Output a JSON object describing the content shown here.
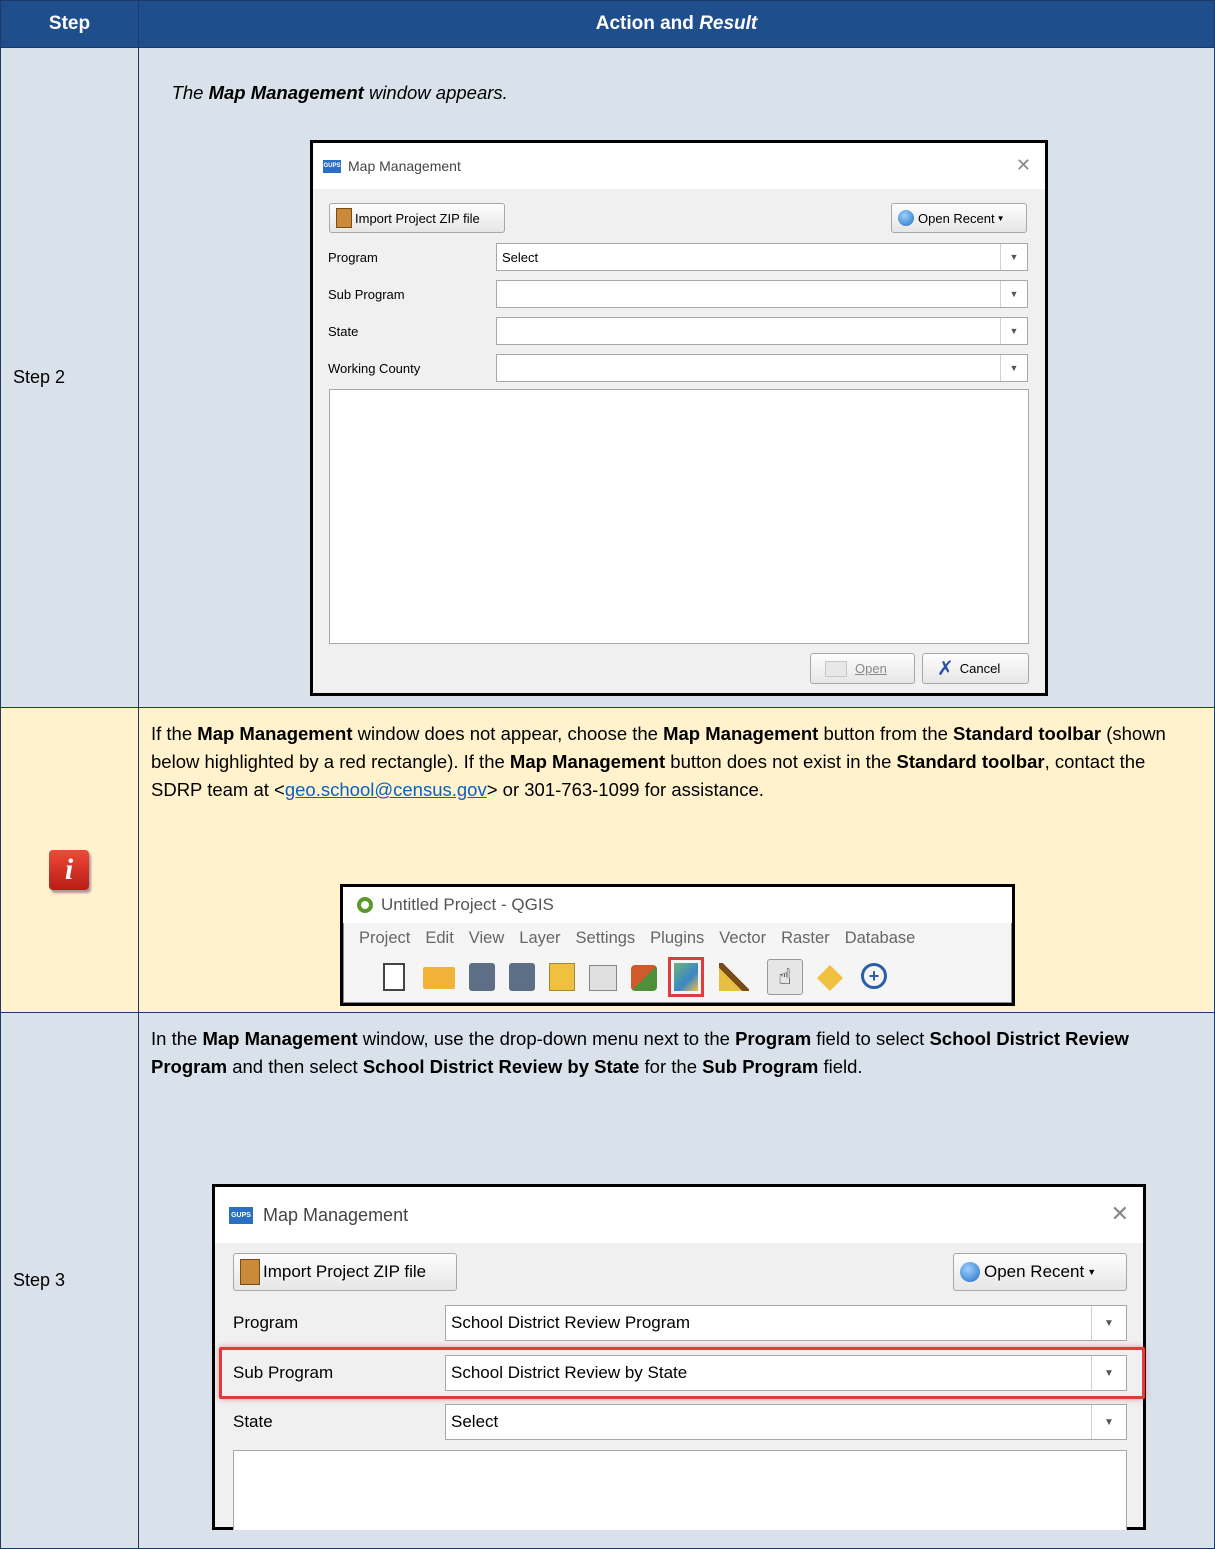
{
  "table": {
    "header_step": "Step",
    "header_action": "Action and ",
    "header_result": "Result"
  },
  "row1": {
    "step": "Step 2",
    "caption_pre": "The ",
    "caption_bold": "Map Management",
    "caption_post": " window appears."
  },
  "dialog1": {
    "title": "Map Management",
    "import_button": "Import Project ZIP file",
    "open_recent_button": "Open Recent",
    "labels": [
      "Program",
      "Sub Program",
      "State",
      "Working County"
    ],
    "values": [
      "Select",
      "",
      "",
      ""
    ],
    "open_button": "Open",
    "cancel_button": "Cancel"
  },
  "note": {
    "t1": "If the ",
    "b1": "Map Management",
    "t2": " window does not appear, choose the ",
    "b2": "Map Management",
    "t3": " button from the ",
    "b3": "Standard toolbar",
    "t4": " (shown below highlighted by a red rectangle). If the ",
    "b4": "Map Management",
    "t5": " button does not exist in the ",
    "b5": "Standard toolbar",
    "t6": ", contact the SDRP team at <",
    "email": "geo.school@census.gov",
    "t7": "> or 301-763-1099 for assistance.",
    "info_icon_letter": "i"
  },
  "qgis": {
    "title": "Untitled Project - QGIS",
    "menu": [
      "Project",
      "Edit",
      "View",
      "Layer",
      "Settings",
      "Plugins",
      "Vector",
      "Raster",
      "Database"
    ]
  },
  "row3": {
    "step": "Step 3",
    "t1": "In the ",
    "b1": "Map Management",
    "t2": " window, use the drop-down menu next to the ",
    "b2": "Program",
    "t3": " field to select ",
    "b3": "School District Review Program",
    "t4": " and then select ",
    "b4": "School District Review by State",
    "t5": " for the ",
    "b5": "Sub Program",
    "t6": " field."
  },
  "dialog2": {
    "title": "Map Management",
    "import_button": "Import Project ZIP file",
    "open_recent_button": "Open Recent",
    "labels": [
      "Program",
      "Sub Program",
      "State"
    ],
    "values": [
      "School District Review Program",
      "School District Review by State",
      "Select"
    ]
  },
  "colors": {
    "header_bg": "#1f4e8c",
    "row_gray": "#d9e1ea",
    "row_yellow": "#fff2cc",
    "highlight_red": "#e03c3c",
    "link": "#0563c1"
  }
}
